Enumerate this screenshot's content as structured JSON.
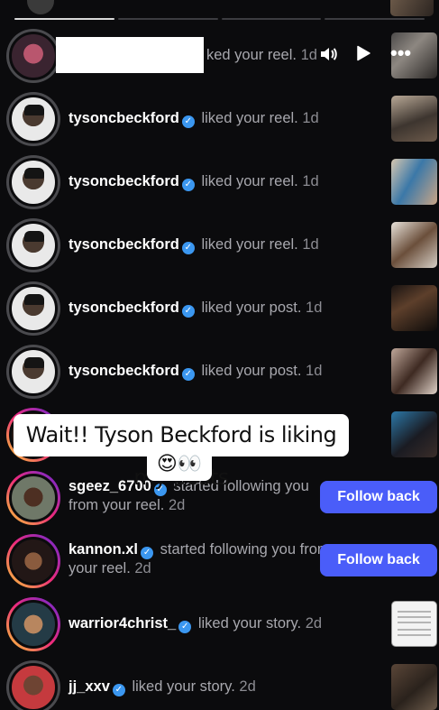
{
  "notifications": [
    {
      "username": "",
      "action": "ked your reel.",
      "ago": "1d"
    },
    {
      "username": "tysoncbeckford",
      "action": "liked your reel.",
      "ago": "1d"
    },
    {
      "username": "tysoncbeckford",
      "action": "liked your reel.",
      "ago": "1d"
    },
    {
      "username": "tysoncbeckford",
      "action": "liked your reel.",
      "ago": "1d"
    },
    {
      "username": "tysoncbeckford",
      "action": "liked your post.",
      "ago": "1d"
    },
    {
      "username": "tysoncbeckford",
      "action": "liked your post.",
      "ago": "1d"
    },
    {
      "username": "sgeez_6700",
      "action": "started following you from your reel.",
      "ago": "2d",
      "button": "Follow back"
    },
    {
      "username": "kannon.xl",
      "action": "started following you from your reel.",
      "ago": "2d",
      "button": "Follow back"
    },
    {
      "username": "warrior4christ_",
      "action": "liked your story.",
      "ago": "2d"
    },
    {
      "username": "jj_xxv",
      "action": "liked your story.",
      "ago": "2d"
    }
  ],
  "caption": {
    "line1": "Wait!! Tyson Beckford is liking my posts",
    "line2": "😍👀"
  },
  "icons": {
    "verified": "verified-badge-icon",
    "speaker": "speaker-icon",
    "play": "play-icon",
    "more": "more-dots-icon"
  },
  "colors": {
    "accent": "#4a5df9",
    "verified": "#3b97f0",
    "background": "#0b0b0d"
  }
}
